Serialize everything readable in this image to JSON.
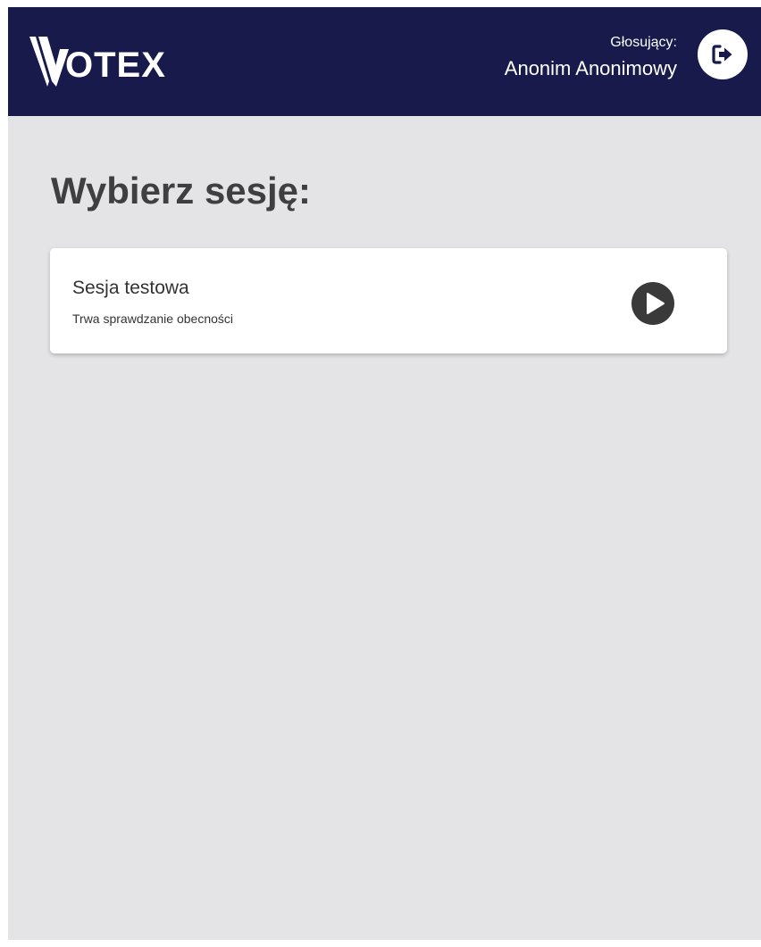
{
  "header": {
    "logo_text": "OTEX",
    "voter_label": "Głosujący:",
    "voter_name": "Anonim Anonimowy",
    "logout_icon": "logout-icon",
    "background_color": "#171a4a"
  },
  "main": {
    "title": "Wybierz sesję:",
    "sessions": [
      {
        "name": "Sesja testowa",
        "status": "Trwa sprawdzanie obecności",
        "action_icon": "play-icon"
      }
    ]
  },
  "colors": {
    "page_background": "#e4e4e6",
    "card_background": "#ffffff",
    "text_dark": "#3f3f3f",
    "icon_dark": "#3a3a3a"
  }
}
